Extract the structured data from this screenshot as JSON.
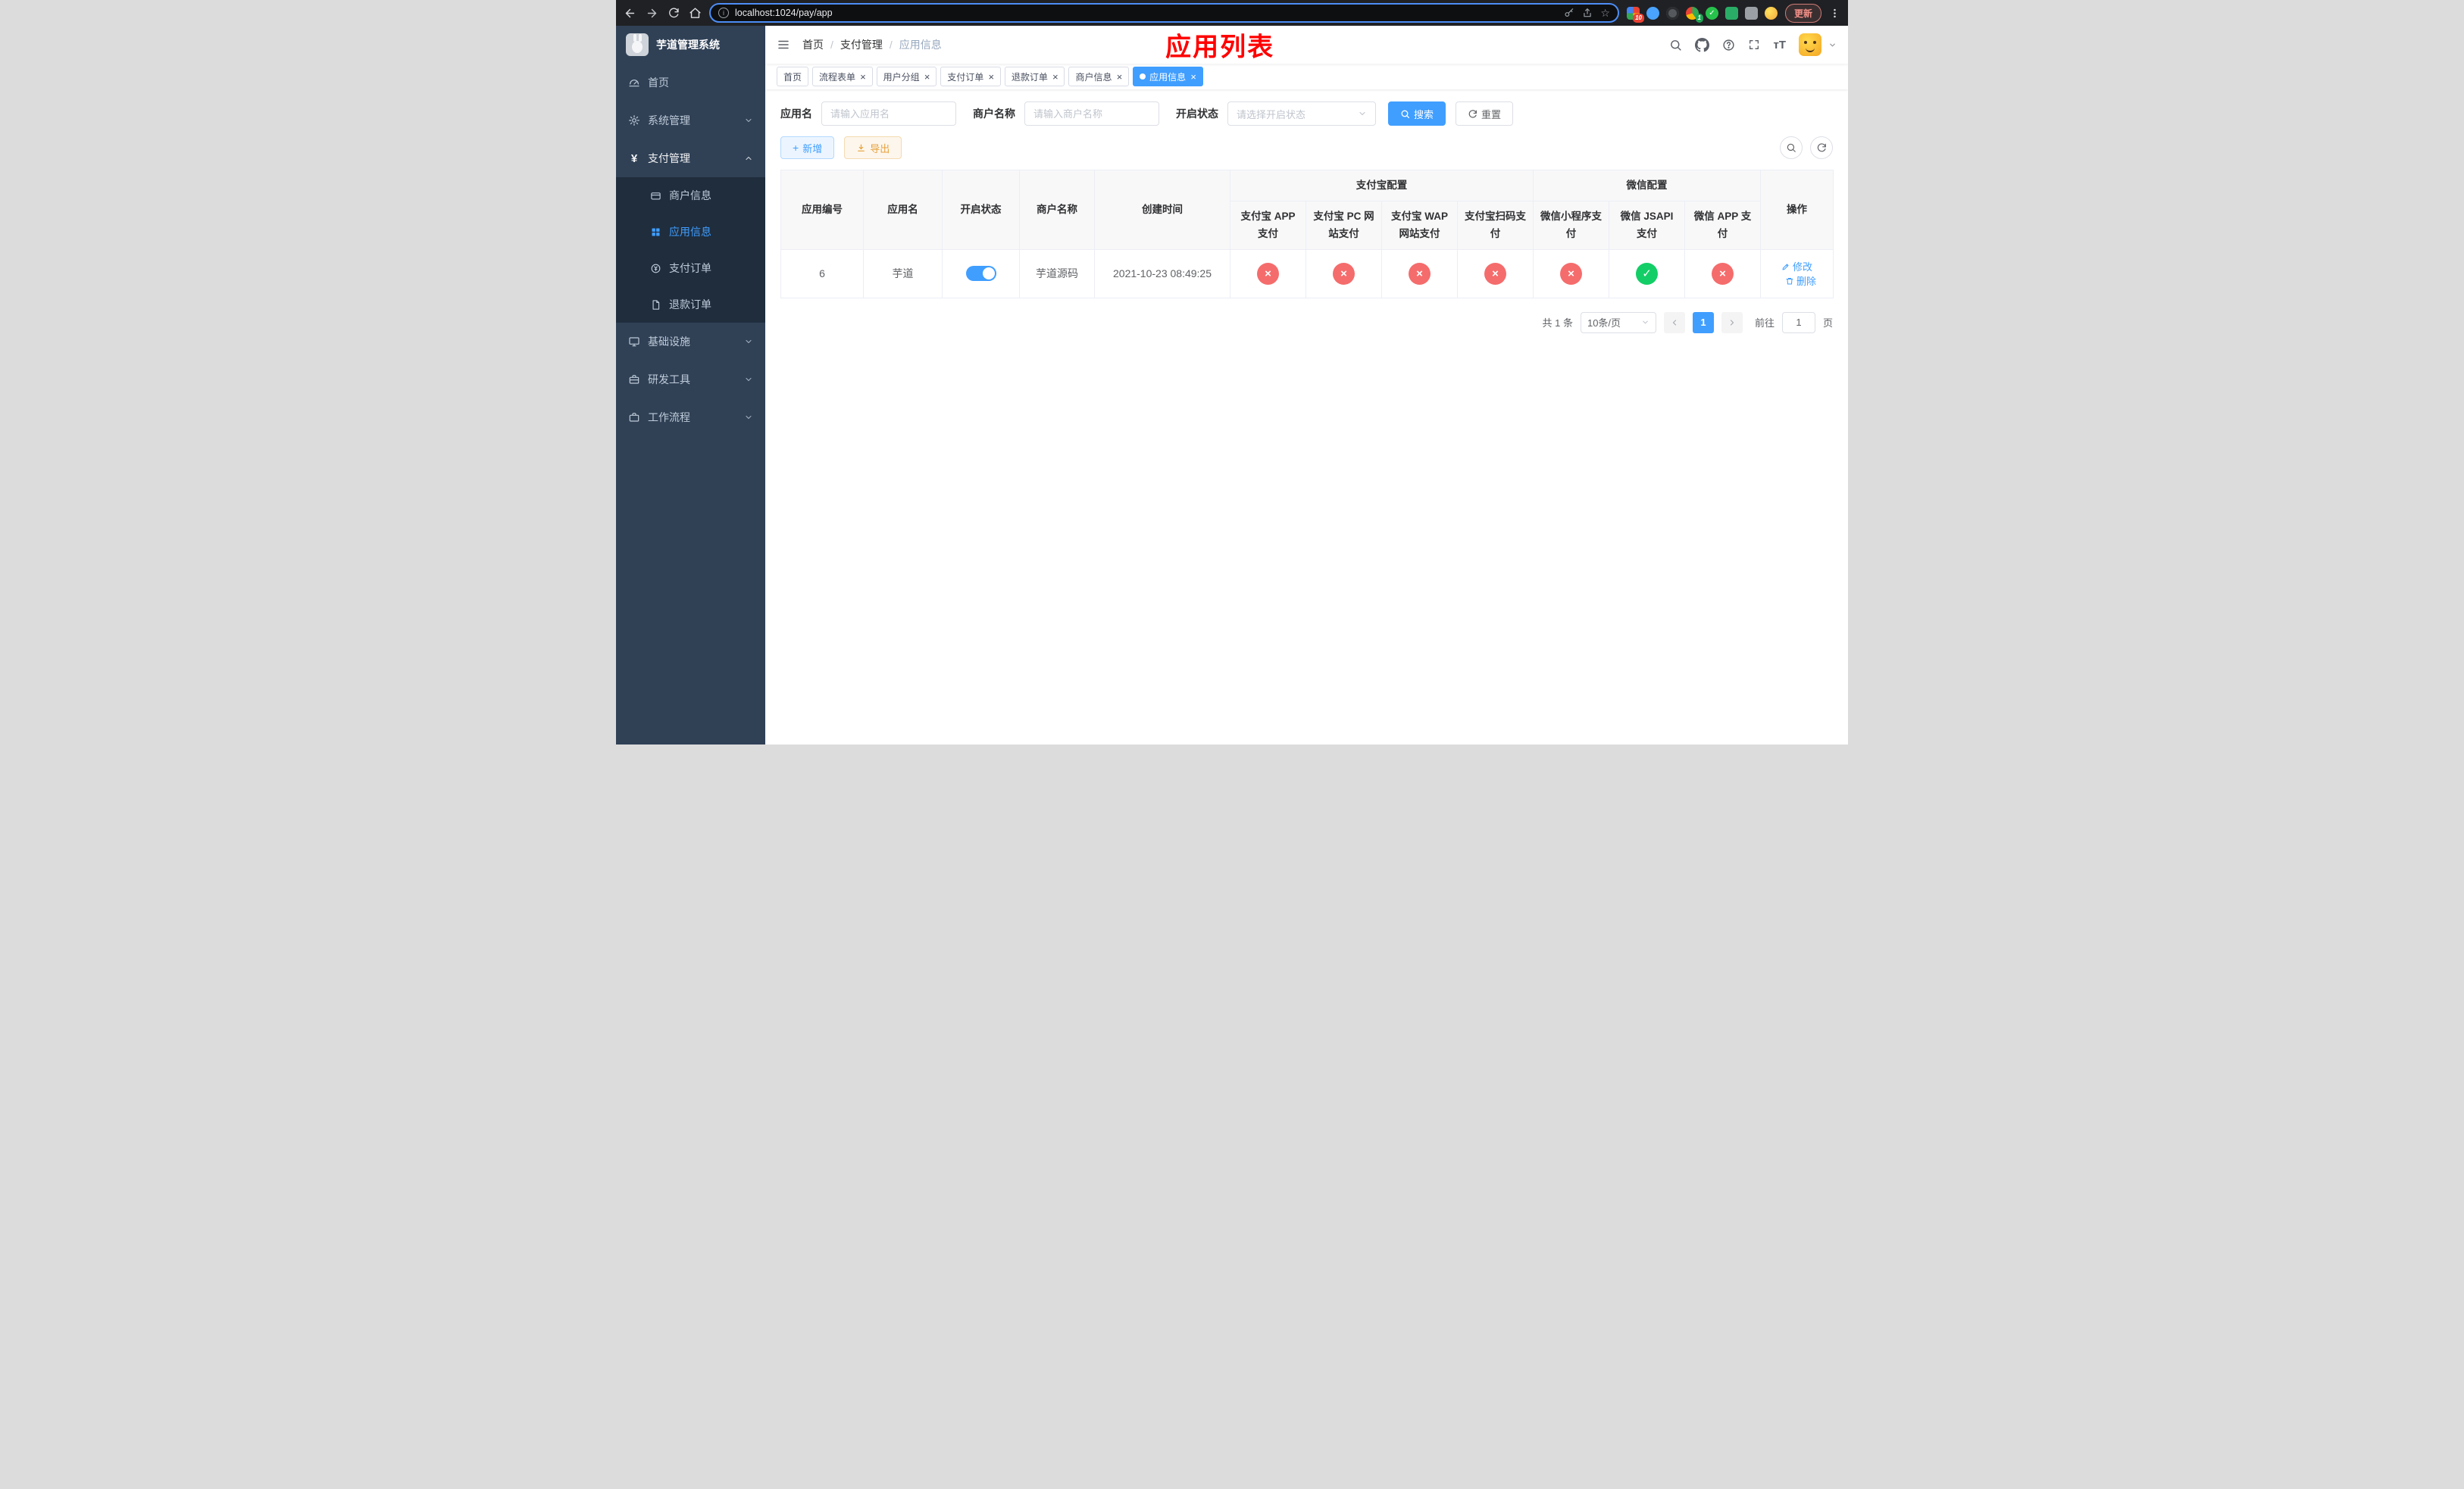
{
  "browser": {
    "url": "localhost:1024/pay/app",
    "update_label": "更新",
    "badges": [
      "10",
      "1"
    ]
  },
  "sidebar": {
    "logo_title": "芋道管理系统",
    "items": [
      {
        "label": "首页"
      },
      {
        "label": "系统管理"
      },
      {
        "label": "支付管理",
        "children": [
          {
            "label": "商户信息"
          },
          {
            "label": "应用信息",
            "active": true
          },
          {
            "label": "支付订单"
          },
          {
            "label": "退款订单"
          }
        ]
      },
      {
        "label": "基础设施"
      },
      {
        "label": "研发工具"
      },
      {
        "label": "工作流程"
      }
    ]
  },
  "header": {
    "breadcrumb": [
      "首页",
      "支付管理",
      "应用信息"
    ],
    "annotation": "应用列表"
  },
  "tabs": [
    {
      "label": "首页",
      "closable": false,
      "active": false
    },
    {
      "label": "流程表单",
      "closable": true,
      "active": false
    },
    {
      "label": "用户分组",
      "closable": true,
      "active": false
    },
    {
      "label": "支付订单",
      "closable": true,
      "active": false
    },
    {
      "label": "退款订单",
      "closable": true,
      "active": false
    },
    {
      "label": "商户信息",
      "closable": true,
      "active": false
    },
    {
      "label": "应用信息",
      "closable": true,
      "active": true
    }
  ],
  "filters": {
    "app_name_label": "应用名",
    "app_name_placeholder": "请输入应用名",
    "merchant_label": "商户名称",
    "merchant_placeholder": "请输入商户名称",
    "status_label": "开启状态",
    "status_placeholder": "请选择开启状态",
    "search_label": "搜索",
    "reset_label": "重置"
  },
  "toolbar": {
    "add_label": "新增",
    "export_label": "导出"
  },
  "table": {
    "groups": {
      "alipay": "支付宝配置",
      "wechat": "微信配置"
    },
    "columns": [
      "应用编号",
      "应用名",
      "开启状态",
      "商户名称",
      "创建时间",
      "支付宝 APP 支付",
      "支付宝 PC 网站支付",
      "支付宝 WAP 网站支付",
      "支付宝扫码支付",
      "微信小程序支付",
      "微信 JSAPI 支付",
      "微信 APP 支付",
      "操作"
    ],
    "rows": [
      {
        "id": "6",
        "name": "芋道",
        "enabled": true,
        "merchant": "芋道源码",
        "created": "2021-10-23 08:49:25",
        "statuses": [
          "fail",
          "fail",
          "fail",
          "fail",
          "fail",
          "success",
          "fail"
        ],
        "actions": {
          "edit": "修改",
          "delete": "删除"
        }
      }
    ]
  },
  "pagination": {
    "total": "共 1 条",
    "page_size": "10条/页",
    "current_page": "1",
    "goto_label": "前往",
    "goto_value": "1",
    "page_suffix": "页"
  },
  "colors": {
    "accent": "#409eff",
    "danger": "#f56c6c",
    "success": "#13ce66",
    "sidebar": "#304156",
    "annotation": "#ff0000"
  }
}
